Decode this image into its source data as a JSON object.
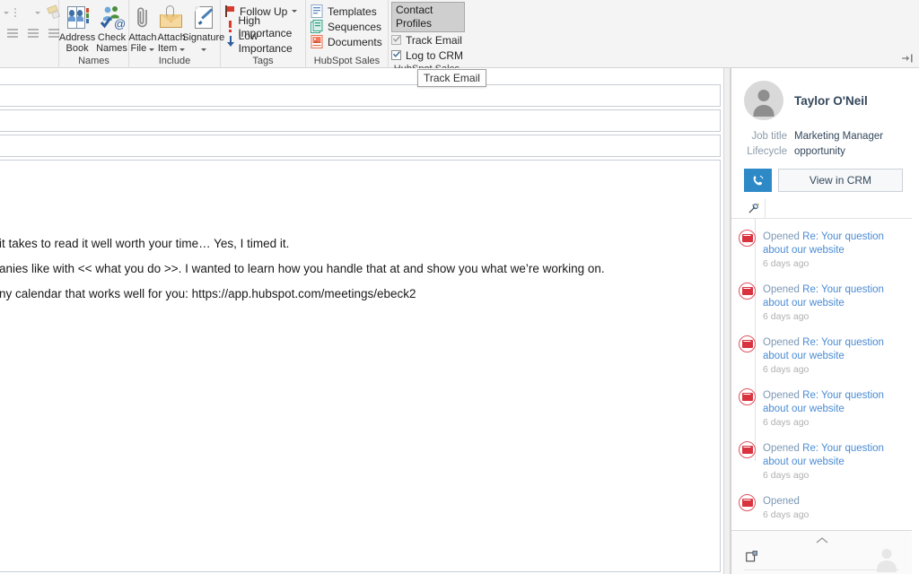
{
  "ribbon": {
    "groups": [
      {
        "label": "",
        "name": "paragraph-group"
      },
      {
        "label": "Names",
        "name": "names-group"
      },
      {
        "label": "Include",
        "name": "include-group"
      },
      {
        "label": "Tags",
        "name": "tags-group"
      },
      {
        "label": "HubSpot Sales Tools",
        "name": "hubspot-sales-tools-group"
      },
      {
        "label": "HubSpot Sales",
        "name": "hubspot-sales-group"
      }
    ],
    "names": {
      "address_book": "Address\nBook",
      "address_book_line1": "Address",
      "address_book_line2": "Book",
      "check_names_line1": "Check",
      "check_names_line2": "Names"
    },
    "include": {
      "attach_file_line1": "Attach",
      "attach_file_line2": "File",
      "attach_item_line1": "Attach",
      "attach_item_line2": "Item",
      "signature_line1": "Signature",
      "signature_line2": ""
    },
    "tags": {
      "follow_up": "Follow Up",
      "high_importance": "High Importance",
      "low_importance": "Low Importance"
    },
    "hubspot_tools": {
      "templates": "Templates",
      "sequences": "Sequences",
      "documents": "Documents"
    },
    "hubspot_sales": {
      "contact_profiles": "Contact Profiles",
      "track_email": "Track Email",
      "log_to_crm": "Log to CRM",
      "track_email_checked": true,
      "track_email_disabled": true,
      "log_to_crm_checked": true
    }
  },
  "tooltip": {
    "text": "Track Email"
  },
  "compose": {
    "to_value": "",
    "cc_value": "",
    "subject_value": "",
    "body_lines": [
      "it takes to read it well worth your time… Yes, I timed it.",
      "anies like with << what you do >>. I wanted to learn how you handle that at and show you what we’re working on.",
      "ny calendar that works well for you: https://app.hubspot.com/meetings/ebeck2"
    ]
  },
  "sidebar": {
    "contact": {
      "name": "Taylor O'Neil",
      "properties": [
        {
          "key": "Job title",
          "value": "Marketing Manager"
        },
        {
          "key": "Lifecycle",
          "value": "opportunity"
        }
      ],
      "call_button_icon": "phone-icon",
      "view_in_crm": "View in CRM"
    },
    "timeline": [
      {
        "action": "Opened",
        "subject": "Re: Your question about our website",
        "time": "6 days ago"
      },
      {
        "action": "Opened",
        "subject": "Re: Your question about our website",
        "time": "6 days ago"
      },
      {
        "action": "Opened",
        "subject": "Re: Your question about our website",
        "time": "6 days ago"
      },
      {
        "action": "Opened",
        "subject": "Re: Your question about our website",
        "time": "6 days ago"
      },
      {
        "action": "Opened",
        "subject": "Re: Your question about our website",
        "time": "6 days ago"
      },
      {
        "action": "Opened",
        "subject": "",
        "time": "6 days ago"
      }
    ]
  },
  "colors": {
    "ribbon_bg": "#f4f4f4",
    "accent_blue": "#2d8ac7",
    "link_blue": "#4a8bd4",
    "muted_blue": "#7c98b6",
    "activity_red": "#d8333f",
    "hubspot_orange": "#f5795c"
  }
}
